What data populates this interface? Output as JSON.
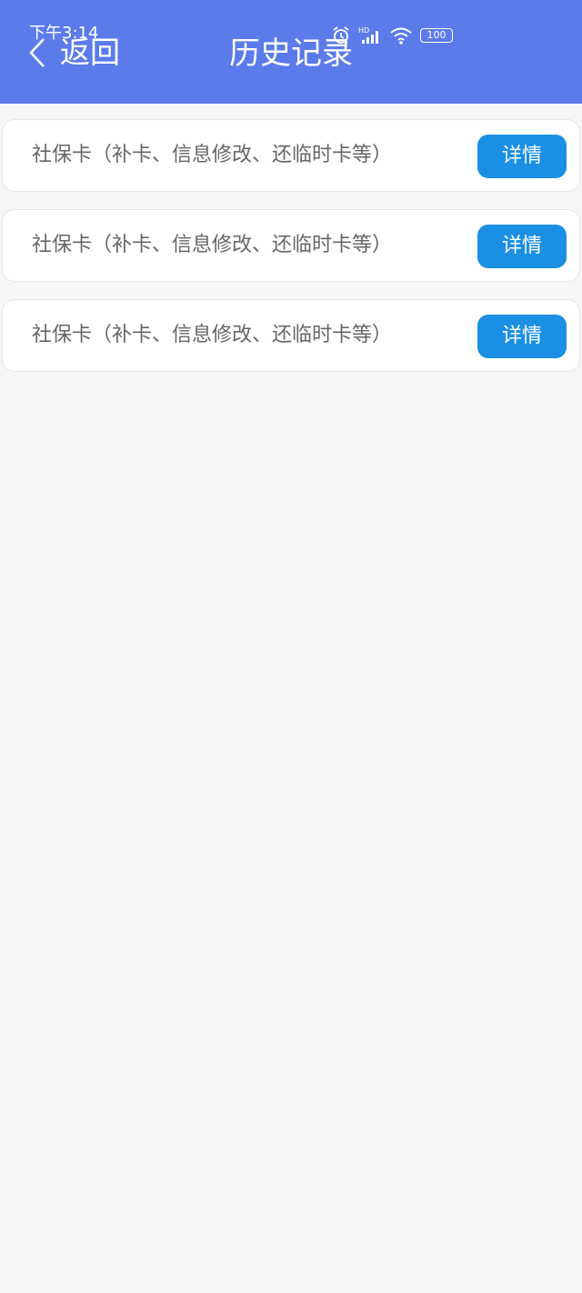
{
  "status_bar": {
    "time": "下午3:14",
    "icons": [
      "alarm-icon",
      "hd-signal-icon",
      "wifi-icon",
      "battery-icon"
    ],
    "battery_level": "100"
  },
  "header": {
    "back_label": "返回",
    "title": "历史记录",
    "background_color": "#5b7bea"
  },
  "records": [
    {
      "title": "社保卡（补卡、信息修改、还临时卡等）",
      "button_label": "详情"
    },
    {
      "title": "社保卡（补卡、信息修改、还临时卡等）",
      "button_label": "详情"
    },
    {
      "title": "社保卡（补卡、信息修改、还临时卡等）",
      "button_label": "详情"
    }
  ],
  "colors": {
    "accent_button": "#1a8fe3",
    "page_background": "#f7f7f7"
  }
}
